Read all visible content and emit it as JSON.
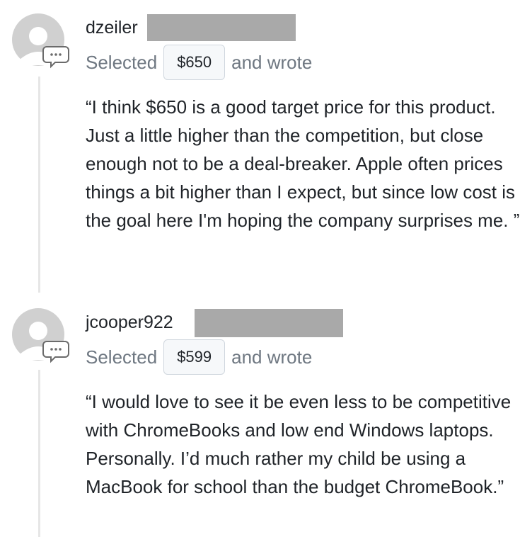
{
  "comments": [
    {
      "username": "dzeiler",
      "selected_label": "Selected",
      "price": "$650",
      "wrote_label": "and wrote",
      "text": "“I think $650 is a good target price for this product. Just a little higher than the competition, but close enough not to be a deal-breaker. Apple often prices things a bit higher than I expect, but since low cost is the goal here I'm hoping the company surprises me. ”",
      "avatar_icon": "user-avatar-placeholder",
      "badge_icon": "comment-bubble-icon"
    },
    {
      "username": "jcooper922",
      "selected_label": "Selected",
      "price": "$599",
      "wrote_label": "and wrote",
      "text": "“I would love to see it be even less to be competitive with ChromeBooks and low end Windows laptops. Personally. I’d much rather my child be using a MacBook for school than the budget ChromeBook.”",
      "avatar_icon": "user-avatar-placeholder",
      "badge_icon": "comment-bubble-icon"
    }
  ],
  "colors": {
    "avatar": "#cfcfcf",
    "redaction": "#a9a9a9",
    "muted_text": "#6e7781",
    "pill_background": "#f6f8fa",
    "thread_line": "#e6e6e6"
  }
}
